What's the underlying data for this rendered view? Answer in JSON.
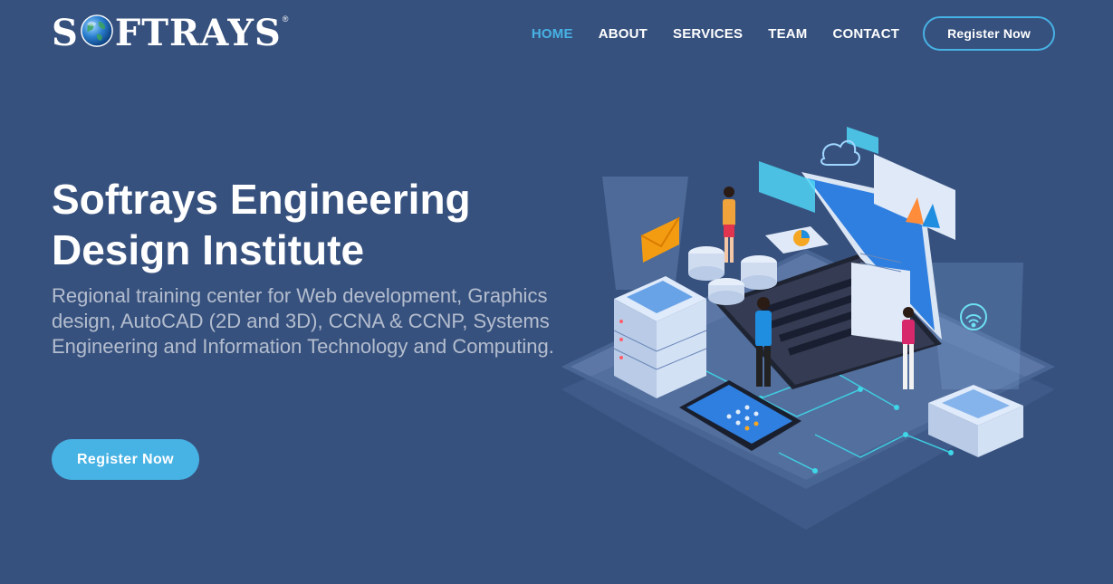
{
  "brand": {
    "logo_text_left": "S",
    "logo_text_right": "FTRAYS",
    "logo_reg": "®"
  },
  "nav": {
    "items": [
      {
        "label": "HOME",
        "active": true
      },
      {
        "label": "ABOUT",
        "active": false
      },
      {
        "label": "SERVICES",
        "active": false
      },
      {
        "label": "TEAM",
        "active": false
      },
      {
        "label": "CONTACT",
        "active": false
      }
    ],
    "register_label": "Register Now"
  },
  "hero": {
    "title": "Softrays Engineering Design Institute",
    "subtitle": "Regional training center for Web development, Graphics design, AutoCAD (2D and 3D), CCNA & CCNP, Systems Engineering and Information Technology and Computing.",
    "cta_label": "Register Now"
  },
  "colors": {
    "background": "#37517e",
    "accent": "#47b2e4"
  }
}
